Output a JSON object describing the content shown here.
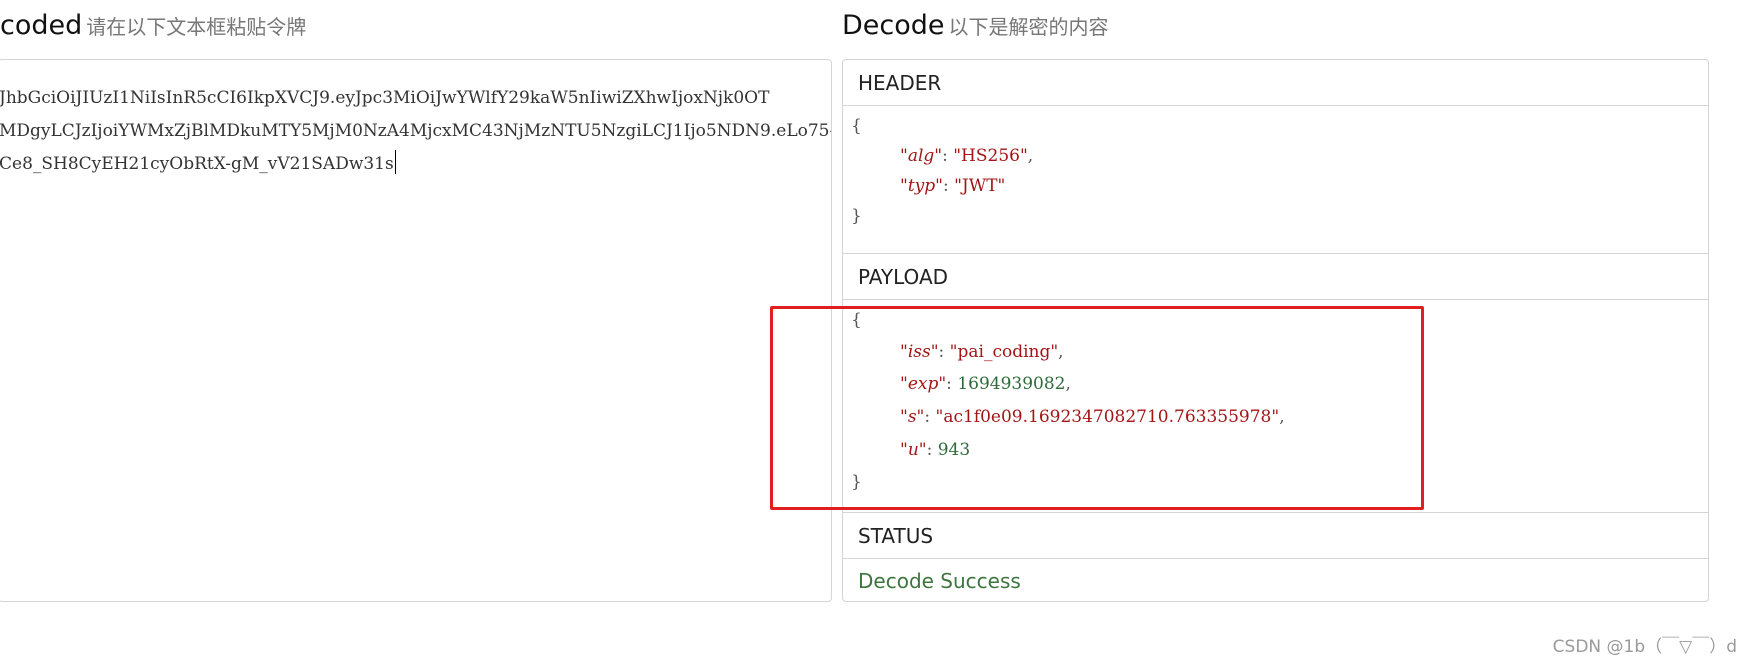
{
  "encoded": {
    "title": "coded",
    "subtitle": "请在以下文本框粘贴令牌",
    "lines": [
      "JhbGciOiJIUzI1NiIsInR5cCI6IkpXVCJ9.eyJpc3MiOiJwYWlfY29kaW5nIiwiZXhwIjoxNjk0OT",
      "MDgyLCJzIjoiYWMxZjBlMDkuMTY5MjM0NzA4MjcxMC43NjMzNTU5NzgiLCJ1Ijo5NDN9.eLo75-",
      "Ce8_SH8CyEH21cyObRtX-gM_vV21SADw31s"
    ]
  },
  "decode": {
    "title": "Decode",
    "subtitle": "以下是解密的内容",
    "header": {
      "label": "HEADER",
      "open": "{",
      "close": "}",
      "fields": [
        {
          "key": "\"alg\"",
          "value": "\"HS256\"",
          "sep": ": ",
          "trail": ","
        },
        {
          "key": "\"typ\"",
          "value": "\"JWT\"",
          "sep": ": ",
          "trail": ""
        }
      ]
    },
    "payload": {
      "label": "PAYLOAD",
      "open": "{",
      "close": "}",
      "fields": [
        {
          "key": "\"iss\"",
          "value": "\"pai_coding\"",
          "sep": ": ",
          "trail": ","
        },
        {
          "key": "\"exp\"",
          "value": "1694939082",
          "sep": ": ",
          "trail": ","
        },
        {
          "key": "\"s\"",
          "value": "\"ac1f0e09.1692347082710.763355978\"",
          "sep": ": ",
          "trail": ","
        },
        {
          "key": "\"u\"",
          "value": "943",
          "sep": ": ",
          "trail": ""
        }
      ]
    },
    "status": {
      "label": "STATUS",
      "text": "Decode Success"
    }
  },
  "watermark": "CSDN @1b（￣▽￣）d",
  "colors": {
    "key": "#a31515",
    "string": "#a31515",
    "number": "#2e6b3a",
    "success": "#3c763d",
    "highlight": "#e02020",
    "border": "#d4d4d4"
  }
}
